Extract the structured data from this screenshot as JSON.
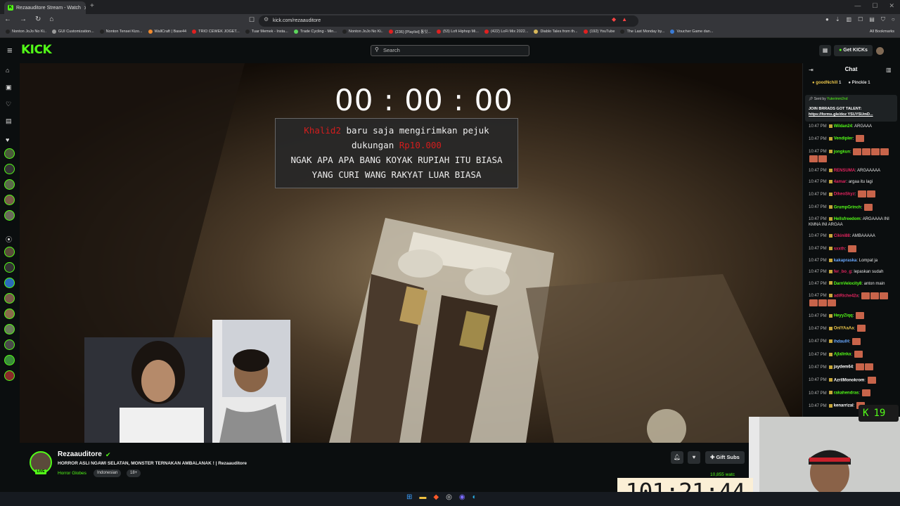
{
  "browser": {
    "tab_title": "Rezaauditore Stream - Watch",
    "url": "kick.com/rezaauditore",
    "new_tab": "+",
    "bookmarks": [
      {
        "label": "Nonton JoJo No Ki..",
        "color": "#222"
      },
      {
        "label": "GUI Customization...",
        "color": "#9b9b9b"
      },
      {
        "label": "Nonton Tensei Kizo...",
        "color": "#222"
      },
      {
        "label": "WallCraft | Base44",
        "color": "#f28a2c"
      },
      {
        "label": "TRIO CEWEK JOGET...",
        "color": "#e02020"
      },
      {
        "label": "Tuar Memek - Insta...",
        "color": "#222"
      },
      {
        "label": "Trade Cycling - Min...",
        "color": "#5cd65c"
      },
      {
        "label": "Nonton JoJo No Ki..",
        "color": "#222"
      },
      {
        "label": "(236) [Playlist] 통잇...",
        "color": "#e02020"
      },
      {
        "label": "(53) Lofi Hiphop Mi...",
        "color": "#e02020"
      },
      {
        "label": "(422) LoFi Mix 2022...",
        "color": "#e02020"
      },
      {
        "label": "Diablo Tales from th...",
        "color": "#d8b85a"
      },
      {
        "label": "(192) YouTube",
        "color": "#e02020"
      },
      {
        "label": "The Last Monday by...",
        "color": "#222"
      },
      {
        "label": "Voucher Game dan...",
        "color": "#3a7bd5"
      }
    ],
    "all_bookmarks": "All Bookmarks"
  },
  "header": {
    "logo": "KICK",
    "search_placeholder": "Search",
    "get_kicks": "Get KICKs"
  },
  "video": {
    "timer": "00 : 00 : 00",
    "donation": {
      "donor": "Khalid2",
      "line1_mid": " baru saja mengirimkan pejuk",
      "line2_pre": "dukungan ",
      "amount": "Rp10.000",
      "message_line1": "NGAK APA APA BANG KOYAK RUPIAH ITU BIASA",
      "message_line2": "YANG CURI WANG RAKYAT LUAR BIASA"
    }
  },
  "channel": {
    "name": "Rezaauditore",
    "live": "LIVE",
    "title": "HORROR ASLI NGAWI SELATAN, MONSTER TERNAKAN AMBALANAK ! | Rezaauditore",
    "category": "Horror Globes",
    "tags": [
      "Indonesian",
      "18+"
    ],
    "gift_subs": "Gift Subs",
    "viewers": "10,855 watc"
  },
  "overlay": {
    "big_timer": "101:21:44",
    "kick_count": "19"
  },
  "chat": {
    "title": "Chat",
    "pinned_users": [
      {
        "name": "goodNchill",
        "count": "1"
      },
      {
        "name": "Pinckie",
        "count": "1"
      }
    ],
    "pinned_sent_by": "Sent by",
    "pinned_sender": "Yuterimm2nd",
    "pinned_text": "JOIN BRRADS GOT TALENT:",
    "pinned_link": "https://forms.gle/doz YSUYSUmD...",
    "messages": [
      {
        "time": "10:47 PM",
        "user": "Wildan24",
        "color": "#53fc18",
        "text": "ARGAAA",
        "emotes": 0
      },
      {
        "time": "10:47 PM",
        "user": "Vendipler",
        "color": "#53fc18",
        "text": "",
        "emotes": 1
      },
      {
        "time": "10:47 PM",
        "user": "jongkun",
        "color": "#53fc18",
        "text": "",
        "emotes": 6
      },
      {
        "time": "10:47 PM",
        "user": "RENSUMA",
        "color": "#e0245e",
        "text": "ARGAAAAA",
        "emotes": 0
      },
      {
        "time": "10:47 PM",
        "user": "4amar",
        "color": "#e0245e",
        "text": "argaa itu lagi",
        "emotes": 0
      },
      {
        "time": "10:47 PM",
        "user": "DikeoSkyz",
        "color": "#e0245e",
        "text": "",
        "emotes": 2
      },
      {
        "time": "10:47 PM",
        "user": "GrumpGrinch",
        "color": "#53fc18",
        "text": "",
        "emotes": 1
      },
      {
        "time": "10:47 PM",
        "user": "Hellsfreedom",
        "color": "#53fc18",
        "text": "ARGAAAA INI KMNA INI ARGAA",
        "emotes": 0
      },
      {
        "time": "10:47 PM",
        "user": "Cikini88",
        "color": "#e0245e",
        "text": "AMBAAAAA",
        "emotes": 0
      },
      {
        "time": "10:47 PM",
        "user": "sxxth",
        "color": "#e0245e",
        "text": "",
        "emotes": 1
      },
      {
        "time": "10:47 PM",
        "user": "kakapraska",
        "color": "#6aa9ff",
        "text": "Lompat ja",
        "emotes": 0
      },
      {
        "time": "10:47 PM",
        "user": "fer_bo_g",
        "color": "#e0245e",
        "text": "lepaskan sudah",
        "emotes": 0
      },
      {
        "time": "10:47 PM",
        "user": "DarnVelocity8",
        "color": "#53fc18",
        "text": "anton main",
        "emotes": 0
      },
      {
        "time": "10:47 PM",
        "user": "adiRiche42a",
        "color": "#e0245e",
        "text": "",
        "emotes": 6
      },
      {
        "time": "10:47 PM",
        "user": "HeyyZiqq",
        "color": "#53fc18",
        "text": "",
        "emotes": 1
      },
      {
        "time": "10:47 PM",
        "user": "OnlYAaAa",
        "color": "#e8c44a",
        "text": "",
        "emotes": 1
      },
      {
        "time": "10:47 PM",
        "user": "ihdaulH",
        "color": "#6aa9ff",
        "text": "",
        "emotes": 1
      },
      {
        "time": "10:47 PM",
        "user": "Ajlalinka",
        "color": "#53fc18",
        "text": "",
        "emotes": 1
      },
      {
        "time": "10:47 PM",
        "user": "jaydem64",
        "color": "#fff",
        "text": "",
        "emotes": 2
      },
      {
        "time": "10:47 PM",
        "user": "AzrilMonokrom",
        "color": "#fff",
        "text": "",
        "emotes": 1
      },
      {
        "time": "10:47 PM",
        "user": "rakahendras",
        "color": "#53fc18",
        "text": "",
        "emotes": 1
      },
      {
        "time": "10:47 PM",
        "user": "kenarrizal",
        "color": "#fff",
        "text": "",
        "emotes": 1
      }
    ]
  }
}
